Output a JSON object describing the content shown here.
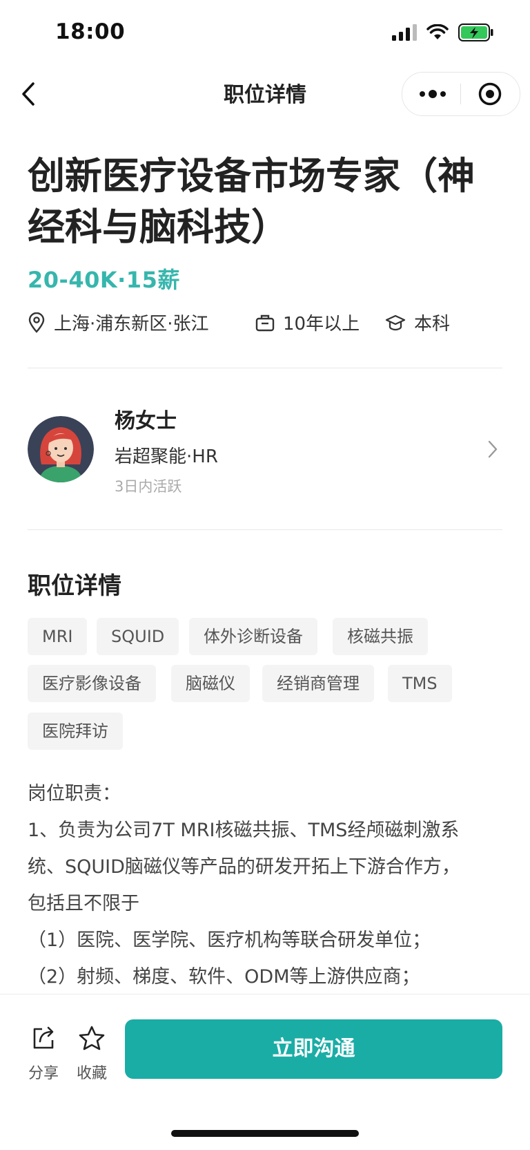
{
  "status_bar": {
    "time": "18:00"
  },
  "nav": {
    "title": "职位详情"
  },
  "job": {
    "title": "创新医疗设备市场专家（神经科与脑科技）",
    "salary": "20-40K·15薪",
    "location": "上海·浦东新区·张江",
    "experience": "10年以上",
    "education": "本科"
  },
  "recruiter": {
    "name": "杨女士",
    "company": "岩超聚能·HR",
    "active": "3日内活跃"
  },
  "details": {
    "section_title": "职位详情",
    "tags": [
      "MRI",
      "SQUID",
      "体外诊断设备",
      "核磁共振",
      "医疗影像设备",
      "脑磁仪",
      "经销商管理",
      "TMS",
      "医院拜访"
    ],
    "description": [
      "岗位职责：",
      "1、负责为公司7T MRI核磁共振、TMS经颅磁刺激系",
      "统、SQUID脑磁仪等产品的研发开拓上下游合作方，",
      "包括且不限于",
      "（1）医院、医学院、医疗机构等联合研发单位；",
      "（2）射频、梯度、软件、ODM等上游供应商；"
    ]
  },
  "bottom": {
    "share_label": "分享",
    "favorite_label": "收藏",
    "cta_label": "立即沟通"
  },
  "colors": {
    "accent": "#1aada6",
    "salary": "#36b6ad"
  }
}
